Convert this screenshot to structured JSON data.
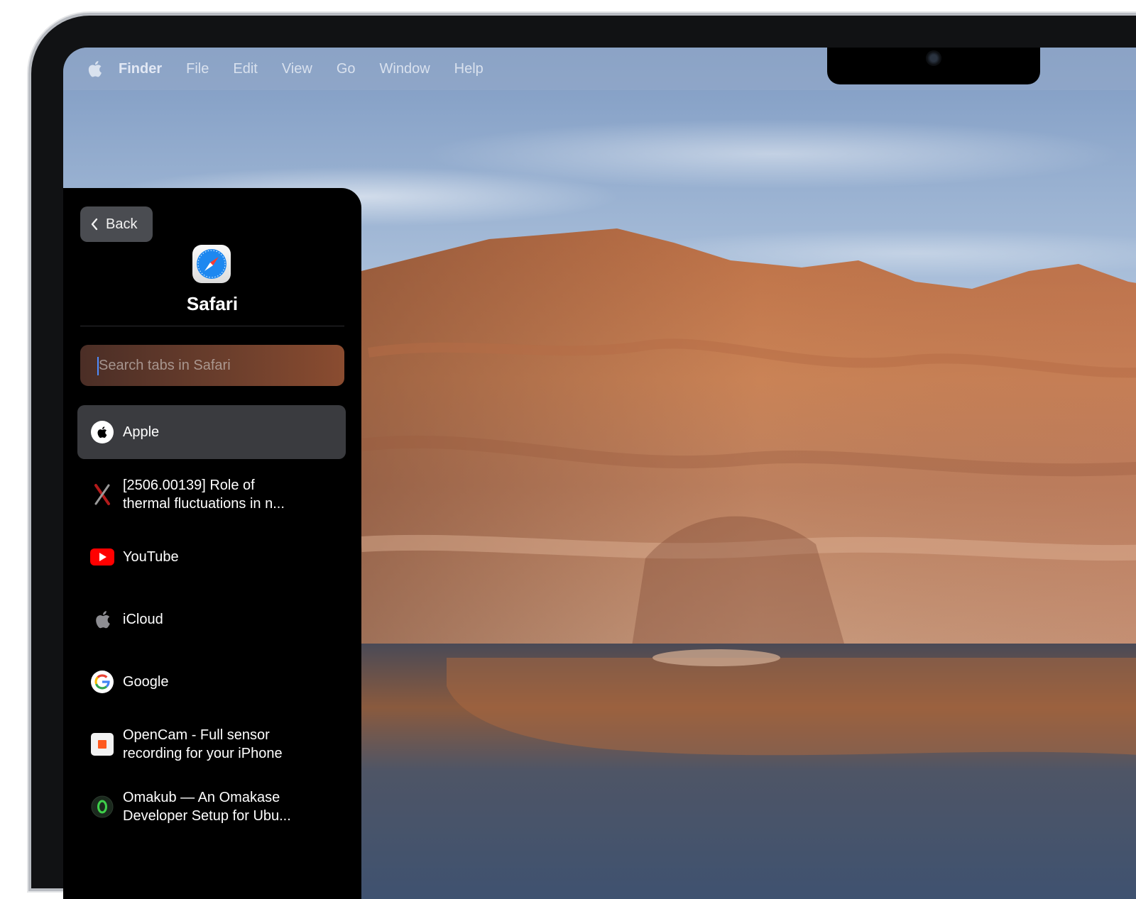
{
  "menubar": {
    "icon": "apple-logo-icon",
    "app_name": "Finder",
    "items": [
      "File",
      "Edit",
      "View",
      "Go",
      "Window",
      "Help"
    ]
  },
  "panel": {
    "back_label": "Back",
    "app_icon": "safari-compass-icon",
    "app_title": "Safari",
    "search_placeholder": "Search tabs in Safari",
    "tabs": [
      {
        "label": "Apple",
        "icon": "apple-favicon",
        "selected": true
      },
      {
        "label": "[2506.00139] Role of\nthermal fluctuations in n...",
        "icon": "arxiv-favicon"
      },
      {
        "label": "YouTube",
        "icon": "youtube-favicon"
      },
      {
        "label": "iCloud",
        "icon": "icloud-apple-favicon"
      },
      {
        "label": "Google",
        "icon": "google-g-favicon"
      },
      {
        "label": "OpenCam - Full sensor\nrecording for your iPhone",
        "icon": "opencam-favicon"
      },
      {
        "label": "Omakub — An Omakase\nDeveloper Setup for Ubu...",
        "icon": "omakub-favicon"
      }
    ]
  },
  "colors": {
    "panel_bg": "#000000",
    "selected_row": "#3a3b3f",
    "back_button": "#4a4c51",
    "search_tint": "#6b3e2c"
  }
}
